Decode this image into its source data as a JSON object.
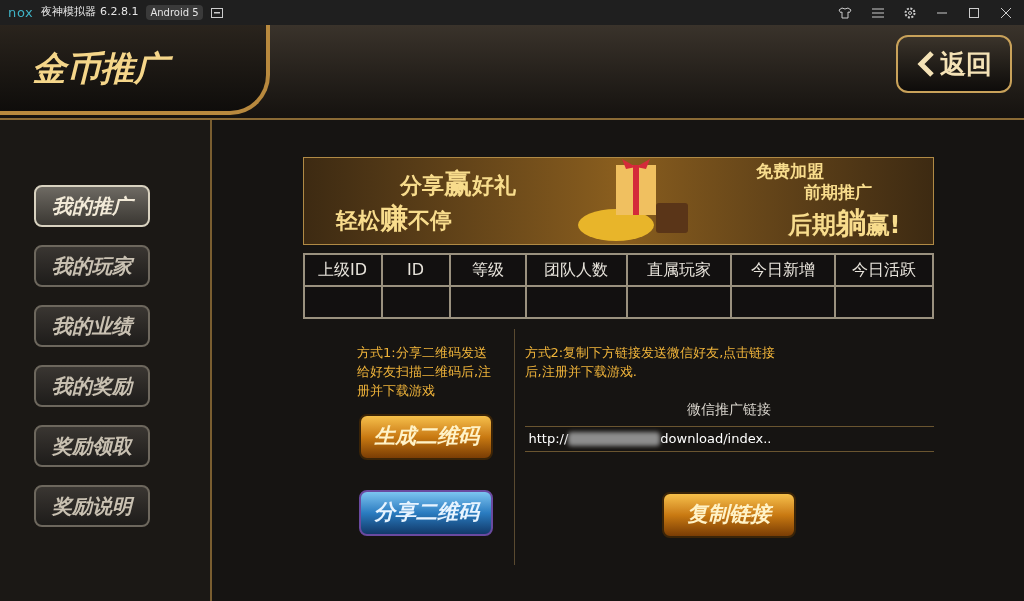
{
  "window": {
    "logo": "nox",
    "title": "夜神模拟器 6.2.8.1",
    "badge": "Android 5"
  },
  "header": {
    "title": "金币推广",
    "back": "返回"
  },
  "sidebar": {
    "items": [
      {
        "label": "我的推广",
        "selected": true
      },
      {
        "label": "我的玩家",
        "selected": false
      },
      {
        "label": "我的业绩",
        "selected": false
      },
      {
        "label": "我的奖励",
        "selected": false
      },
      {
        "label": "奖励领取",
        "selected": false
      },
      {
        "label": "奖励说明",
        "selected": false
      }
    ]
  },
  "banner": {
    "left_line1_a": "分享",
    "left_line1_b": "赢",
    "left_line1_c": "好礼",
    "left_line2_a": "轻松",
    "left_line2_b": "赚",
    "left_line2_c": "不停",
    "right_line1": "免费加盟",
    "right_line2": "前期推广",
    "right_line3_a": "后期",
    "right_line3_b": "躺",
    "right_line3_c": "赢!"
  },
  "table": {
    "columns": [
      "上级ID",
      "ID",
      "等级",
      "团队人数",
      "直属玩家",
      "今日新增",
      "今日活跃"
    ]
  },
  "method1": {
    "text": "方式1:分享二维码发送给好友扫描二维码后,注册并下载游戏",
    "generate_button": "生成二维码",
    "share_button": "分享二维码"
  },
  "method2": {
    "text": "方式2:复制下方链接发送微信好友,点击链接后,注册并下载游戏.",
    "link_label": "微信推广链接",
    "link_prefix": "http://",
    "link_suffix": "download/index..",
    "copy_button": "复制链接"
  }
}
